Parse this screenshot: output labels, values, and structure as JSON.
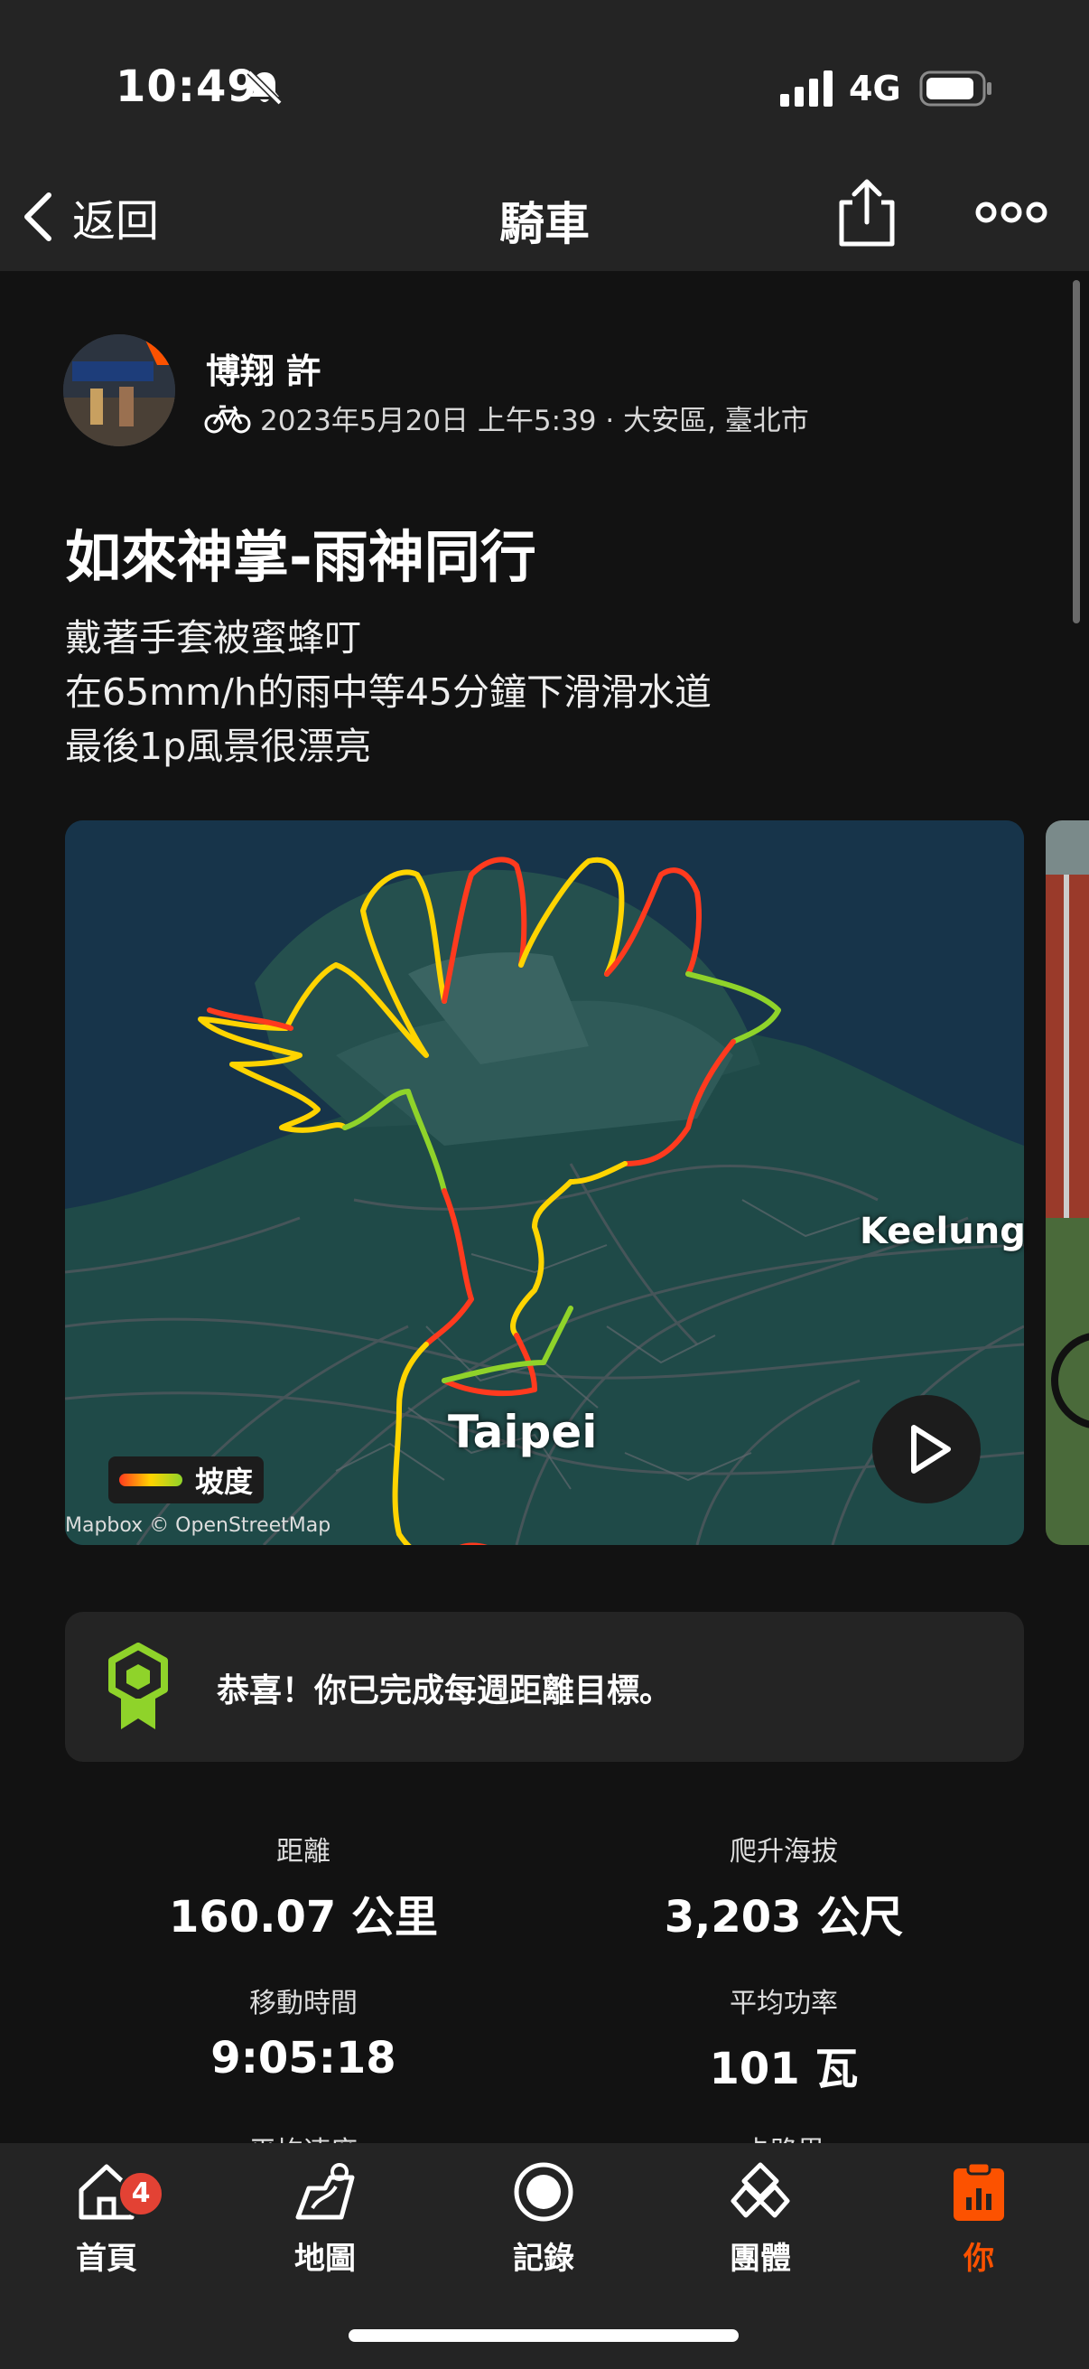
{
  "status_bar": {
    "time": "10:49",
    "network": "4G"
  },
  "nav": {
    "back_label": "返回",
    "title": "騎車"
  },
  "author": {
    "name": "博翔 許",
    "meta": "2023年5月20日 上午5:39 · 大安區, 臺北市"
  },
  "activity": {
    "title": "如來神掌-雨神同行",
    "description": [
      "戴著手套被蜜蜂叮",
      "在65mm/h的雨中等45分鐘下滑滑水道",
      "最後1p風景很漂亮"
    ]
  },
  "map": {
    "label_taipei": "Taipei",
    "label_keelung": "Keelung",
    "legend_label": "坡度",
    "credit": "Mapbox © OpenStreetMap",
    "route_colors": [
      "#ff3a1e",
      "#ffd400",
      "#8fd32a"
    ]
  },
  "goal": {
    "text": "恭喜！你已完成每週距離目標。",
    "icon": "badge-icon",
    "icon_color": "#8fd32a"
  },
  "stats": [
    {
      "label": "距離",
      "value": "160.07 公里"
    },
    {
      "label": "爬升海拔",
      "value": "3,203 公尺"
    },
    {
      "label": "移動時間",
      "value": "9:05:18"
    },
    {
      "label": "平均功率",
      "value": "101 瓦"
    },
    {
      "label": "平均速度",
      "value": ""
    },
    {
      "label": "卡路里",
      "value": ""
    }
  ],
  "tabs": [
    {
      "label": "首頁",
      "icon": "home-icon",
      "badge": "4"
    },
    {
      "label": "地圖",
      "icon": "map-icon"
    },
    {
      "label": "記錄",
      "icon": "record-icon"
    },
    {
      "label": "團體",
      "icon": "groups-icon"
    },
    {
      "label": "你",
      "icon": "you-icon",
      "active": true
    }
  ],
  "colors": {
    "accent": "#fc5200",
    "background": "#121212",
    "surface": "#242424"
  }
}
